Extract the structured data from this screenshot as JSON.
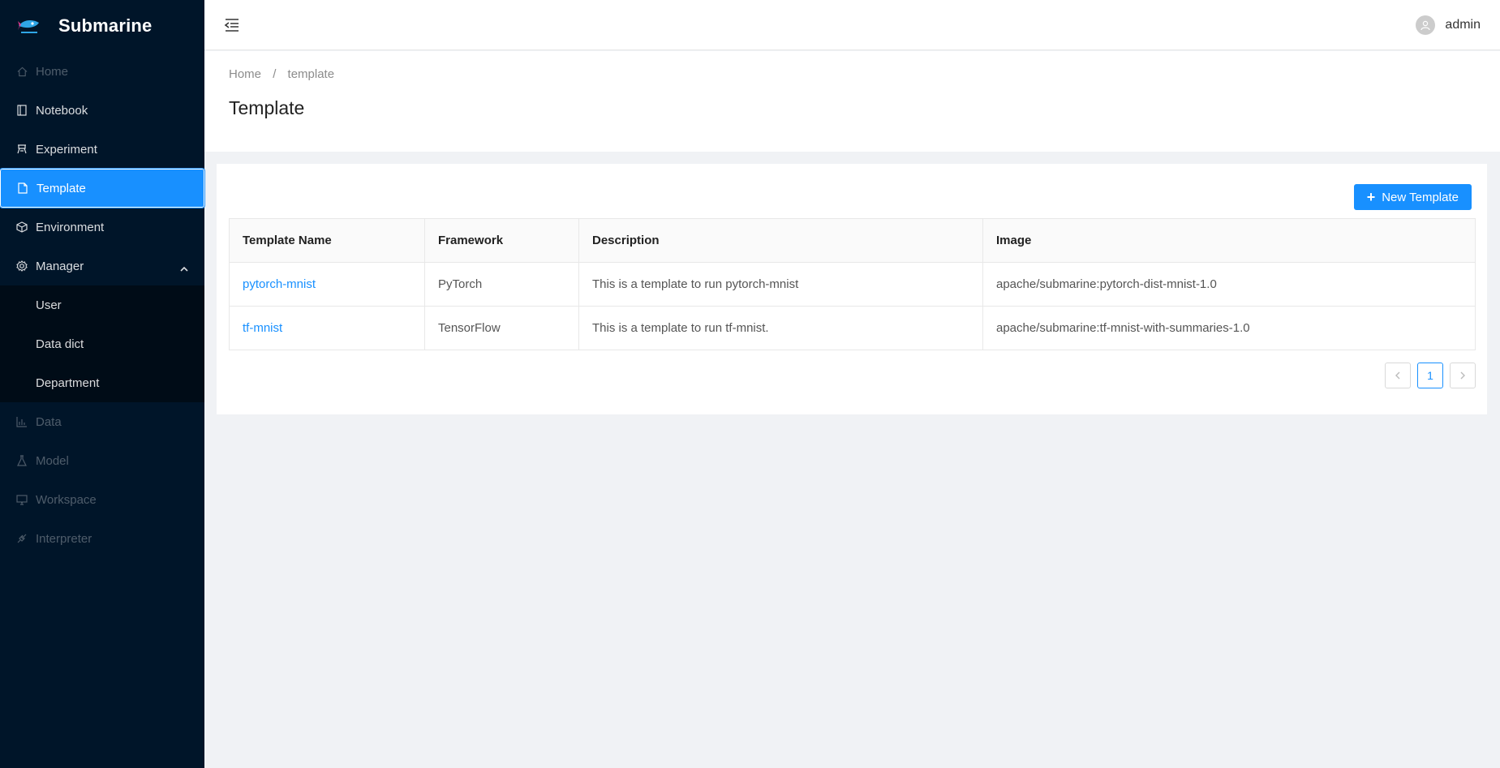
{
  "sidebar": {
    "title": "Submarine",
    "items": [
      {
        "label": "Home",
        "icon": "home-icon"
      },
      {
        "label": "Notebook",
        "icon": "book-icon"
      },
      {
        "label": "Experiment",
        "icon": "experiment-icon"
      },
      {
        "label": "Template",
        "icon": "file-icon"
      },
      {
        "label": "Environment",
        "icon": "code-sandbox-icon"
      },
      {
        "label": "Manager",
        "icon": "setting-icon"
      },
      {
        "label": "Data",
        "icon": "bar-chart-icon"
      },
      {
        "label": "Model",
        "icon": "flask-icon"
      },
      {
        "label": "Workspace",
        "icon": "desktop-icon"
      },
      {
        "label": "Interpreter",
        "icon": "api-icon"
      }
    ],
    "submenu": [
      "User",
      "Data dict",
      "Department"
    ]
  },
  "header": {
    "user": "admin"
  },
  "breadcrumb": {
    "home": "Home",
    "sep": "/",
    "current": "template"
  },
  "page": {
    "title": "Template"
  },
  "toolbar": {
    "new_label": "New Template"
  },
  "table": {
    "columns": [
      "Template Name",
      "Framework",
      "Description",
      "Image"
    ],
    "rows": [
      [
        "pytorch-mnist",
        "PyTorch",
        "This is a template to run pytorch-mnist",
        "apache/submarine:pytorch-dist-mnist-1.0"
      ],
      [
        "tf-mnist",
        "TensorFlow",
        "This is a template to run tf-mnist.",
        "apache/submarine:tf-mnist-with-summaries-1.0"
      ]
    ]
  },
  "pagination": {
    "current": "1"
  },
  "colors": {
    "primary": "#1890ff",
    "sider": "#001529"
  }
}
